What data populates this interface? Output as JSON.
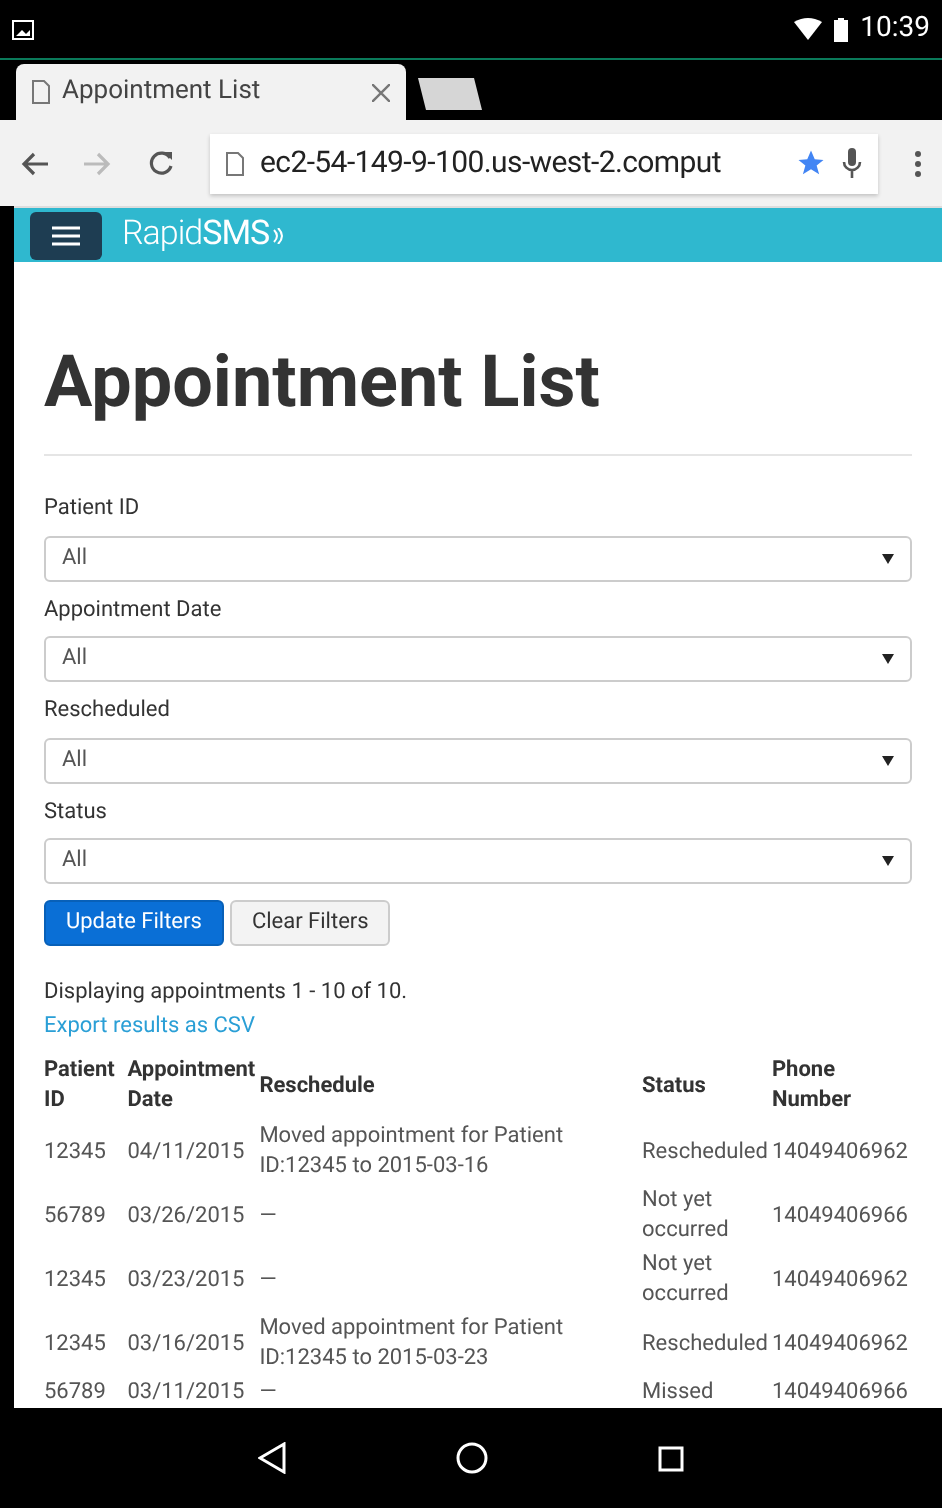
{
  "status_bar": {
    "time": "10:39"
  },
  "browser": {
    "tab_title": "Appointment List",
    "url": "ec2-54-149-9-100.us-west-2.comput"
  },
  "navbar": {
    "brand": "Rapid**SMS**"
  },
  "page": {
    "title": "Appointment List",
    "filters": [
      {
        "label": "Patient ID",
        "value": "All"
      },
      {
        "label": "Appointment Date",
        "value": "All"
      },
      {
        "label": "Rescheduled",
        "value": "All"
      },
      {
        "label": "Status",
        "value": "All"
      }
    ],
    "buttons": [
      {
        "label": "Update Filters",
        "kind": "primary"
      },
      {
        "label": "Clear Filters",
        "kind": "default"
      }
    ],
    "summary": "Displaying appointments 1 - 10 of 10.",
    "export_link": "Export results as CSV",
    "table": {
      "columns": [
        "Patient ID",
        "Appointment Date",
        "Reschedule",
        "Status",
        "Phone Number"
      ],
      "rows": [
        [
          "12345",
          "04/11/2015",
          "Moved appointment for Patient ID:12345 to 2015-03-16",
          "Rescheduled",
          "14049406962"
        ],
        [
          "56789",
          "03/26/2015",
          "—",
          "Not yet occurred",
          "14049406966"
        ],
        [
          "12345",
          "03/23/2015",
          "—",
          "Not yet occurred",
          "14049406962"
        ],
        [
          "12345",
          "03/16/2015",
          "Moved appointment for Patient ID:12345 to 2015-03-23",
          "Rescheduled",
          "14049406962"
        ],
        [
          "56789",
          "03/11/2015",
          "—",
          "Missed",
          "14049406966"
        ]
      ]
    }
  }
}
